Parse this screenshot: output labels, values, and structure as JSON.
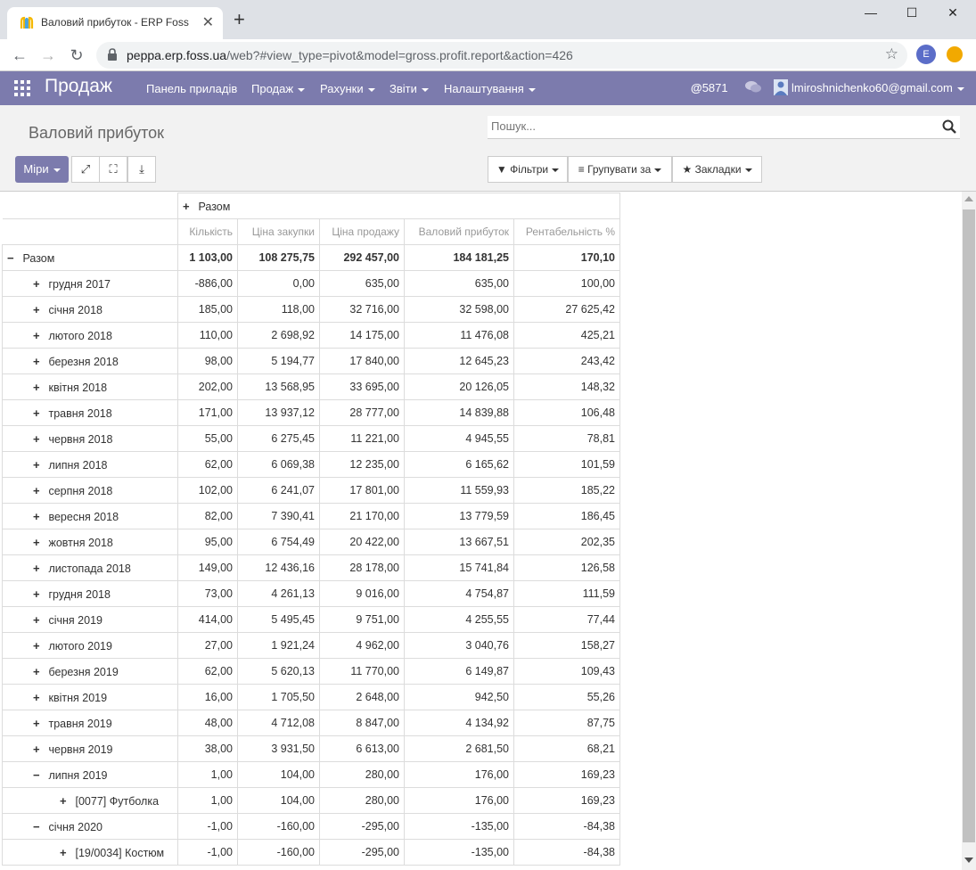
{
  "browser": {
    "tab_title": "Валовий прибуток - ERP Foss",
    "url_host": "peppa.erp.foss.ua",
    "url_path": "/web?#view_type=pivot&model=gross.profit.report&action=426",
    "profile_letter": "E"
  },
  "app": {
    "brand": "Продаж",
    "menu": [
      "Панель приладів",
      "Продаж",
      "Рахунки",
      "Звіти",
      "Налаштування"
    ],
    "messages_count": "5871",
    "user_email": "lmiroshnichenko60@gmail.com"
  },
  "control_panel": {
    "title": "Валовий прибуток",
    "search_placeholder": "Пошук...",
    "measures_label": "Міри",
    "filters_label": "Фільтри",
    "group_by_label": "Групувати за",
    "favorites_label": "Закладки"
  },
  "pivot": {
    "column_group": "Разом",
    "measures": [
      "Кількість",
      "Ціна закупки",
      "Ціна продажу",
      "Валовий прибуток",
      "Рентабельність %"
    ],
    "total": {
      "label": "Разом",
      "values": [
        "1 103,00",
        "108 275,75",
        "292 457,00",
        "184 181,25",
        "170,10"
      ]
    },
    "rows": [
      {
        "label": "грудня 2017",
        "values": [
          "-886,00",
          "0,00",
          "635,00",
          "635,00",
          "100,00"
        ]
      },
      {
        "label": "січня 2018",
        "values": [
          "185,00",
          "118,00",
          "32 716,00",
          "32 598,00",
          "27 625,42"
        ]
      },
      {
        "label": "лютого 2018",
        "values": [
          "110,00",
          "2 698,92",
          "14 175,00",
          "11 476,08",
          "425,21"
        ]
      },
      {
        "label": "березня 2018",
        "values": [
          "98,00",
          "5 194,77",
          "17 840,00",
          "12 645,23",
          "243,42"
        ]
      },
      {
        "label": "квітня 2018",
        "values": [
          "202,00",
          "13 568,95",
          "33 695,00",
          "20 126,05",
          "148,32"
        ]
      },
      {
        "label": "травня 2018",
        "values": [
          "171,00",
          "13 937,12",
          "28 777,00",
          "14 839,88",
          "106,48"
        ]
      },
      {
        "label": "червня 2018",
        "values": [
          "55,00",
          "6 275,45",
          "11 221,00",
          "4 945,55",
          "78,81"
        ]
      },
      {
        "label": "липня 2018",
        "values": [
          "62,00",
          "6 069,38",
          "12 235,00",
          "6 165,62",
          "101,59"
        ]
      },
      {
        "label": "серпня 2018",
        "values": [
          "102,00",
          "6 241,07",
          "17 801,00",
          "11 559,93",
          "185,22"
        ]
      },
      {
        "label": "вересня 2018",
        "values": [
          "82,00",
          "7 390,41",
          "21 170,00",
          "13 779,59",
          "186,45"
        ]
      },
      {
        "label": "жовтня 2018",
        "values": [
          "95,00",
          "6 754,49",
          "20 422,00",
          "13 667,51",
          "202,35"
        ]
      },
      {
        "label": "листопада 2018",
        "values": [
          "149,00",
          "12 436,16",
          "28 178,00",
          "15 741,84",
          "126,58"
        ]
      },
      {
        "label": "грудня 2018",
        "values": [
          "73,00",
          "4 261,13",
          "9 016,00",
          "4 754,87",
          "111,59"
        ]
      },
      {
        "label": "січня 2019",
        "values": [
          "414,00",
          "5 495,45",
          "9 751,00",
          "4 255,55",
          "77,44"
        ]
      },
      {
        "label": "лютого 2019",
        "values": [
          "27,00",
          "1 921,24",
          "4 962,00",
          "3 040,76",
          "158,27"
        ]
      },
      {
        "label": "березня 2019",
        "values": [
          "62,00",
          "5 620,13",
          "11 770,00",
          "6 149,87",
          "109,43"
        ]
      },
      {
        "label": "квітня 2019",
        "values": [
          "16,00",
          "1 705,50",
          "2 648,00",
          "942,50",
          "55,26"
        ]
      },
      {
        "label": "травня 2019",
        "values": [
          "48,00",
          "4 712,08",
          "8 847,00",
          "4 134,92",
          "87,75"
        ]
      },
      {
        "label": "червня 2019",
        "values": [
          "38,00",
          "3 931,50",
          "6 613,00",
          "2 681,50",
          "68,21"
        ]
      },
      {
        "label": "липня 2019",
        "expanded": true,
        "values": [
          "1,00",
          "104,00",
          "280,00",
          "176,00",
          "169,23"
        ]
      },
      {
        "label": "[0077] Футболка",
        "level": 2,
        "values": [
          "1,00",
          "104,00",
          "280,00",
          "176,00",
          "169,23"
        ]
      },
      {
        "label": "січня 2020",
        "expanded": true,
        "values": [
          "-1,00",
          "-160,00",
          "-295,00",
          "-135,00",
          "-84,38"
        ]
      },
      {
        "label": "[19/0034] Костюм",
        "level": 2,
        "values": [
          "-1,00",
          "-160,00",
          "-295,00",
          "-135,00",
          "-84,38"
        ]
      }
    ]
  },
  "colors": {
    "brand": "#7c7bad",
    "panel_bg": "#f2f2f2",
    "border": "#dcdcdc"
  }
}
